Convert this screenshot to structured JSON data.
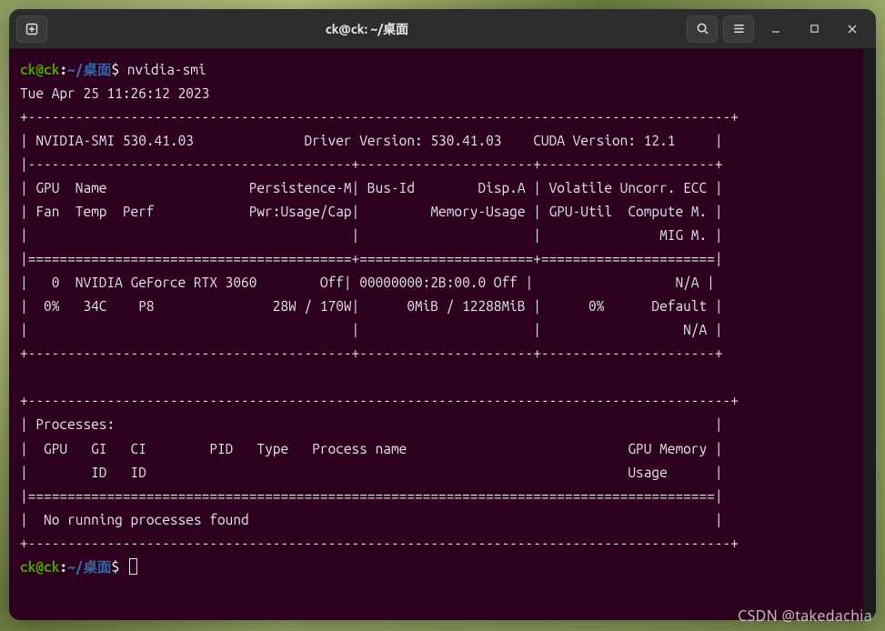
{
  "titlebar": {
    "title": "ck@ck: ~/桌面"
  },
  "prompt": {
    "user_host": "ck@ck",
    "sep": ":",
    "path": "~/桌面",
    "symbol": "$",
    "command": "nvidia-smi"
  },
  "output": {
    "timestamp": "Tue Apr 25 11:26:12 2023",
    "driver_line": "| NVIDIA-SMI 530.41.03              Driver Version: 530.41.03    CUDA Version: 12.1     |",
    "hdr1": "| GPU  Name                  Persistence-M| Bus-Id        Disp.A | Volatile Uncorr. ECC |",
    "hdr2": "| Fan  Temp  Perf            Pwr:Usage/Cap|         Memory-Usage | GPU-Util  Compute M. |",
    "hdr3": "|                                         |                      |               MIG M. |",
    "gpu1": "|   0  NVIDIA GeForce RTX 3060        Off| 00000000:2B:00.0 Off |                  N/A |",
    "gpu2": "|  0%   34C    P8               28W / 170W|      0MiB / 12288MiB |      0%      Default |",
    "gpu3": "|                                         |                      |                  N/A |",
    "proc_title": "| Processes:                                                                            |",
    "proc_hdr1": "|  GPU   GI   CI        PID   Type   Process name                            GPU Memory |",
    "proc_hdr2": "|        ID   ID                                                             Usage      |",
    "proc_none": "|  No running processes found                                                           |",
    "border_top": "+-----------------------------------------------------------------------------------------+",
    "border_sub": "|-----------------------------------------+----------------------+----------------------+",
    "border_thick": "|=========================================+======================+======================|",
    "border_mid": "+-----------------------------------------+----------------------+----------------------+",
    "border_thick2": "|=======================================================================================|"
  },
  "watermark": "CSDN @takedachia"
}
